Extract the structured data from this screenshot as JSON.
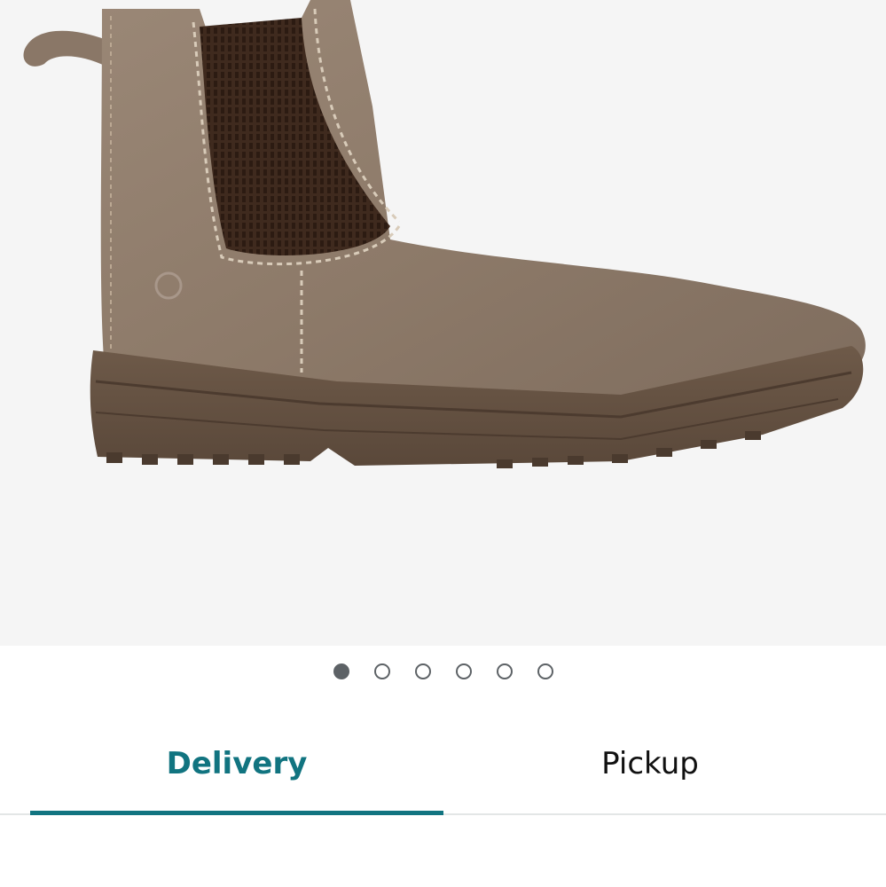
{
  "carousel": {
    "image_icon": "boot-product-image",
    "dots": [
      {
        "state": "active"
      },
      {
        "state": "inactive"
      },
      {
        "state": "inactive"
      },
      {
        "state": "inactive"
      },
      {
        "state": "inactive"
      },
      {
        "state": "inactive"
      }
    ]
  },
  "tabs": {
    "delivery_label": "Delivery",
    "pickup_label": "Pickup",
    "active": "delivery"
  },
  "colors": {
    "accent": "#117480",
    "image_bg": "#f5f5f5",
    "dot": "#5d6266"
  }
}
